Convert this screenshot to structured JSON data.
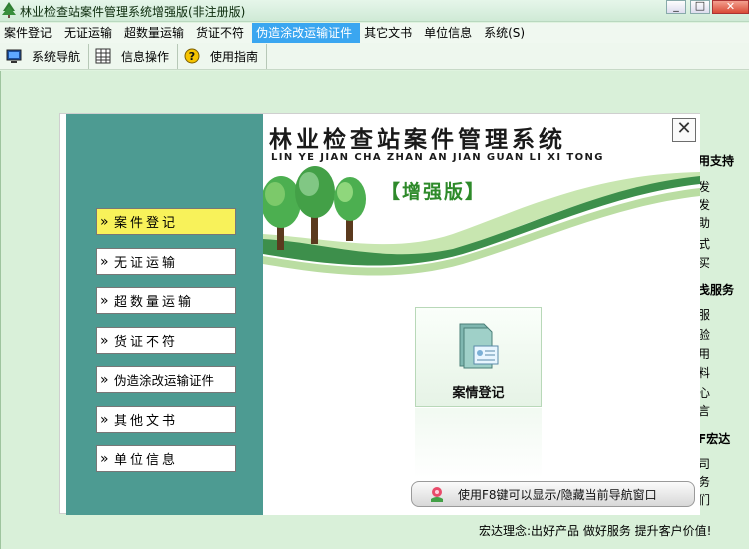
{
  "window": {
    "title": "林业检查站案件管理系统增强版(非注册版)",
    "minimize": "_",
    "maximize": "□",
    "close": "✕"
  },
  "menubar": {
    "items": [
      {
        "label": "案件登记"
      },
      {
        "label": "无证运输"
      },
      {
        "label": "超数量运输"
      },
      {
        "label": "货证不符"
      },
      {
        "label": "伪造涂改运输证件",
        "active": true
      },
      {
        "label": "其它文书"
      },
      {
        "label": "单位信息"
      },
      {
        "label": "系统(S)"
      }
    ]
  },
  "toolbar": {
    "items": [
      {
        "label": "系统导航",
        "icon": "monitor-icon"
      },
      {
        "label": "信息操作",
        "icon": "grid-icon"
      },
      {
        "label": "使用指南",
        "icon": "help-icon"
      }
    ]
  },
  "background": {
    "right_lines": [
      {
        "text": "用支持",
        "bold": true
      },
      {
        "text": "发"
      },
      {
        "text": "发"
      },
      {
        "text": "助"
      },
      {
        "text": "式"
      },
      {
        "text": "买"
      },
      {
        "text": "戋服务",
        "bold": true
      },
      {
        "text": "服"
      },
      {
        "text": "验"
      },
      {
        "text": "用"
      },
      {
        "text": "料"
      },
      {
        "text": "心"
      },
      {
        "text": "言"
      },
      {
        "text": "F宏达",
        "bold": true
      },
      {
        "text": "司"
      },
      {
        "text": "务"
      },
      {
        "text": "们"
      }
    ],
    "bottom_note": "宏达理念:出好产品 做好服务 提升客户价值!"
  },
  "dialog": {
    "system_title": "林业检查站案件管理系统",
    "system_pinyin": "LIN YE JIAN CHA ZHAN AN JIAN GUAN LI XI TONG",
    "edition": "【增强版】",
    "close": "✕",
    "nav_items": [
      {
        "label": "案件登记",
        "selected": true
      },
      {
        "label": "无证运输"
      },
      {
        "label": "超数量运输"
      },
      {
        "label": "货证不符"
      },
      {
        "label": "伪造涂改运输证件"
      },
      {
        "label": "其他文书"
      },
      {
        "label": "单位信息"
      }
    ],
    "action_label": "案情登记",
    "hint": "使用F8键可以显示/隐藏当前导航窗口"
  },
  "colors": {
    "nav_panel": "#4d9b92",
    "selected_nav": "#f8f25a",
    "active_menu": "#3aa6f0",
    "background": "#d9f0d9"
  }
}
